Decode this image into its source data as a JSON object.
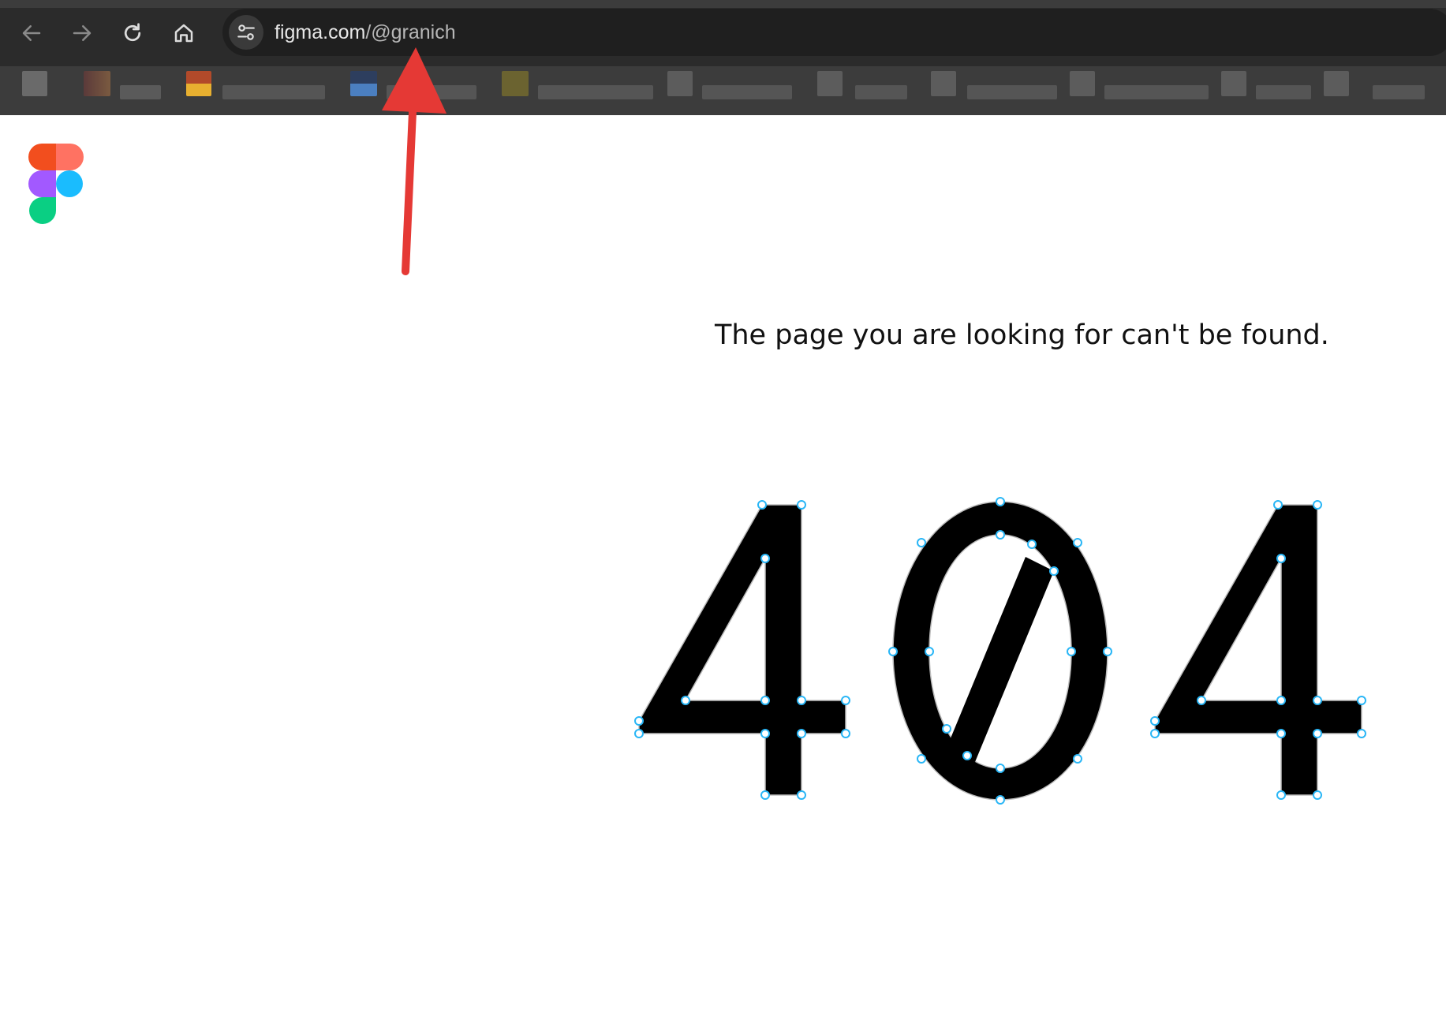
{
  "browser": {
    "url_domain": "figma.com",
    "url_path": "/@granich",
    "icons": {
      "back": "back-arrow-icon",
      "forward": "forward-arrow-icon",
      "reload": "reload-icon",
      "home": "home-icon",
      "site_info": "site-settings-icon"
    }
  },
  "page": {
    "message": "The page you are looking for can't be found.",
    "error_code": "404",
    "logo": "figma-logo",
    "annotation": "red-arrow-pointing-to-url"
  },
  "colors": {
    "toolbar": "#2b2b2b",
    "bookmarks_bar": "#3c3c3c",
    "annotation_red": "#e53935",
    "node_handle": "#29b6f6"
  }
}
